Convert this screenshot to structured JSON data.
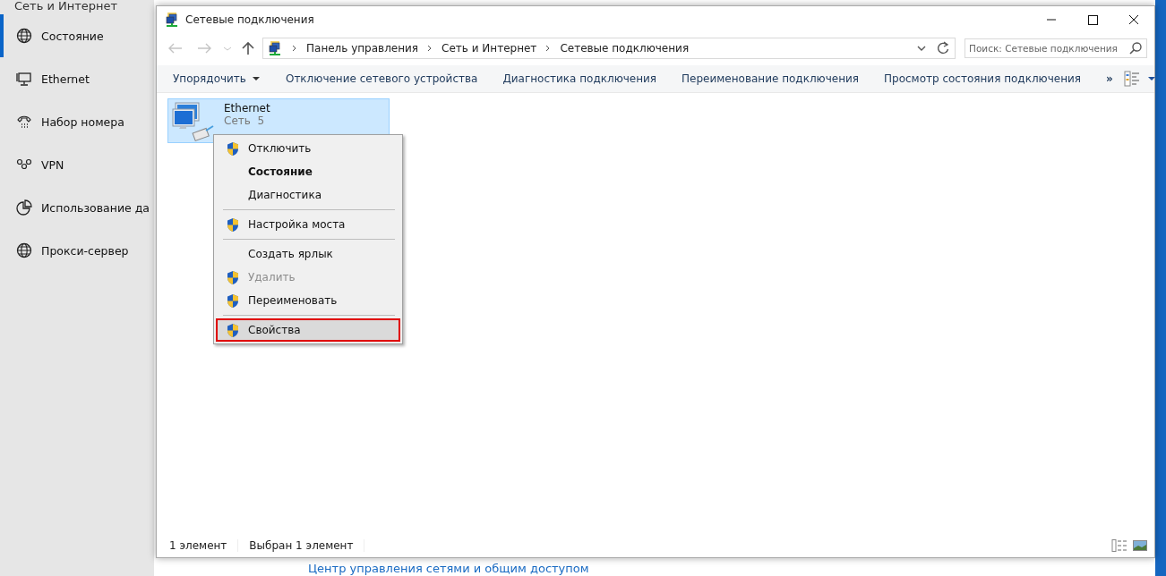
{
  "settings": {
    "header": "Сеть и Интернет",
    "nav": [
      {
        "label": "Состояние",
        "selected": true
      },
      {
        "label": "Ethernet",
        "selected": false
      },
      {
        "label": "Набор номера",
        "selected": false
      },
      {
        "label": "VPN",
        "selected": false
      },
      {
        "label": "Использование да",
        "selected": false
      },
      {
        "label": "Прокси-сервер",
        "selected": false
      }
    ],
    "link": "Центр управления сетями и общим доступом"
  },
  "window": {
    "title": "Сетевые подключения",
    "address": [
      "Панель управления",
      "Сеть и Интернет",
      "Сетевые подключения"
    ],
    "search": {
      "placeholder": "Поиск: Сетевые подключения"
    },
    "toolbar": [
      {
        "label": "Упорядочить",
        "dropdown": true
      },
      {
        "label": "Отключение сетевого устройства",
        "dropdown": false
      },
      {
        "label": "Диагностика подключения",
        "dropdown": false
      },
      {
        "label": "Переименование подключения",
        "dropdown": false
      },
      {
        "label": "Просмотр состояния подключения",
        "dropdown": false
      }
    ],
    "more": "»",
    "items": [
      {
        "name": "Ethernet",
        "subtitle": "Сеть  5",
        "selected": true
      }
    ],
    "context_menu": [
      {
        "kind": "item",
        "label": "Отключить",
        "shield": true,
        "bold": false,
        "disabled": false,
        "selected": false
      },
      {
        "kind": "item",
        "label": "Состояние",
        "shield": false,
        "bold": true,
        "disabled": false,
        "selected": false
      },
      {
        "kind": "item",
        "label": "Диагностика",
        "shield": false,
        "bold": false,
        "disabled": false,
        "selected": false
      },
      {
        "kind": "separator"
      },
      {
        "kind": "item",
        "label": "Настройка моста",
        "shield": true,
        "bold": false,
        "disabled": false,
        "selected": false
      },
      {
        "kind": "separator"
      },
      {
        "kind": "item",
        "label": "Создать ярлык",
        "shield": false,
        "bold": false,
        "disabled": false,
        "selected": false
      },
      {
        "kind": "item",
        "label": "Удалить",
        "shield": true,
        "bold": false,
        "disabled": true,
        "selected": false
      },
      {
        "kind": "item",
        "label": "Переименовать",
        "shield": true,
        "bold": false,
        "disabled": false,
        "selected": false
      },
      {
        "kind": "separator"
      },
      {
        "kind": "item",
        "label": "Свойства",
        "shield": true,
        "bold": false,
        "disabled": false,
        "selected": true
      }
    ],
    "status": [
      "1 элемент",
      "Выбран 1 элемент"
    ]
  }
}
